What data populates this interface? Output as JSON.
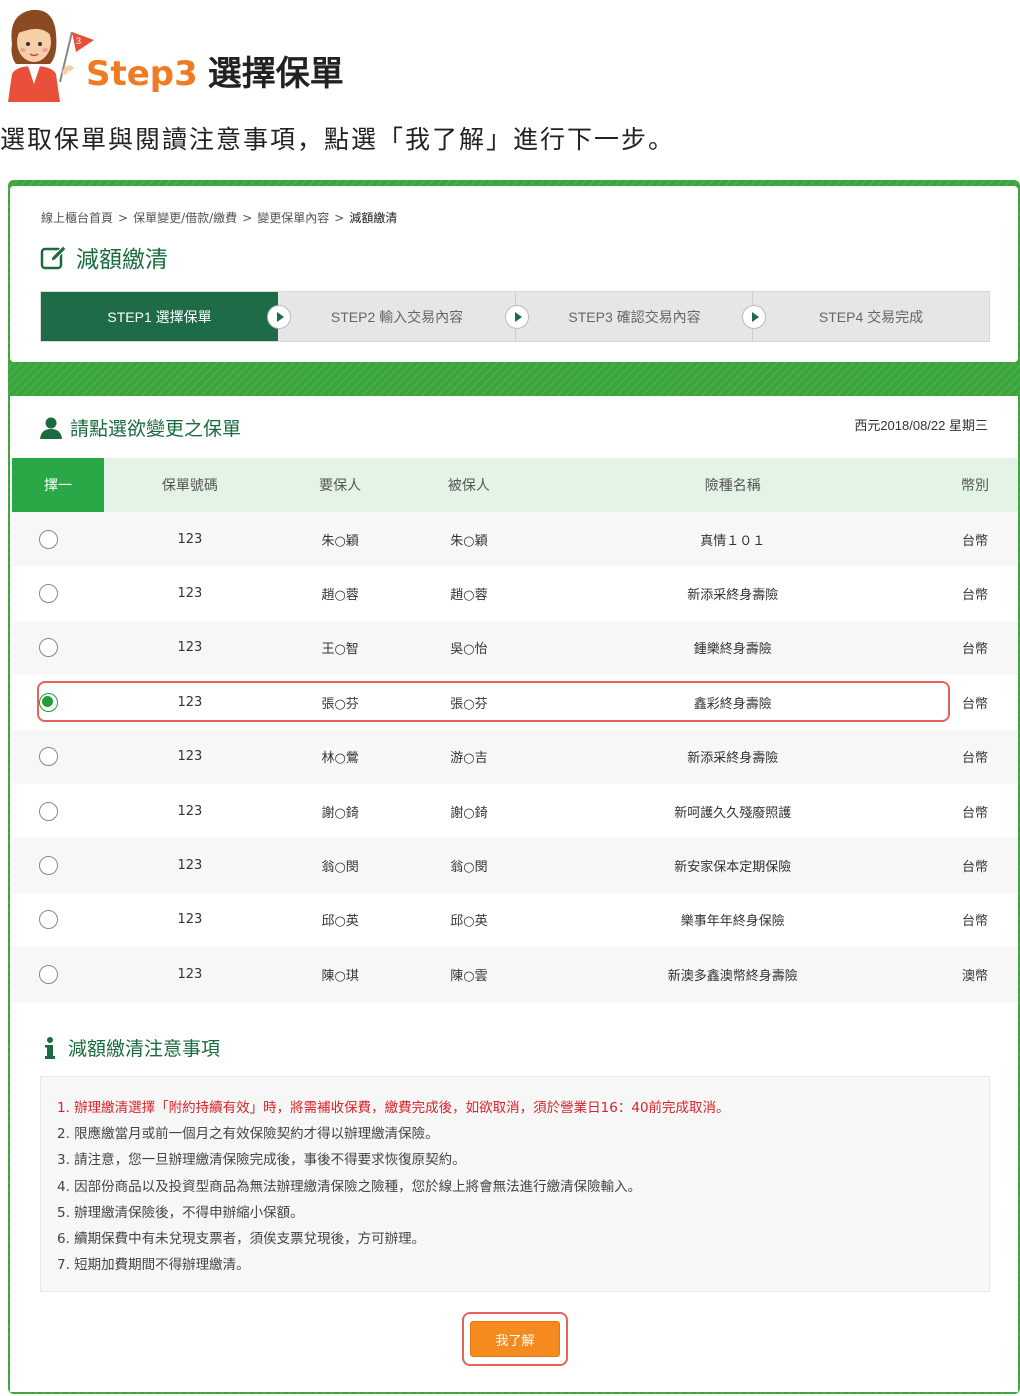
{
  "header": {
    "step_num": "Step3",
    "step_name": "選擇保單",
    "instruction": "選取保單與閱讀注意事項，點選「我了解」進行下一步。"
  },
  "breadcrumb": {
    "items": [
      "線上櫃台首頁",
      "保單變更/借款/繳費",
      "變更保單內容"
    ],
    "current": "減額繳清",
    "separator": ">"
  },
  "page_title": "減額繳清",
  "steps": [
    {
      "label": "STEP1 選擇保單",
      "active": true
    },
    {
      "label": "STEP2 輸入交易內容",
      "active": false
    },
    {
      "label": "STEP3 確認交易內容",
      "active": false
    },
    {
      "label": "STEP4 交易完成",
      "active": false
    }
  ],
  "policy_section": {
    "title": "請點選欲變更之保單",
    "date": "西元2018/08/22 星期三",
    "columns": [
      "擇一",
      "保單號碼",
      "要保人",
      "被保人",
      "險種名稱",
      "幣別"
    ],
    "rows": [
      {
        "no": "123",
        "applicant": "朱○穎",
        "insured": "朱○穎",
        "plan": "真情１０１",
        "currency": "台幣",
        "selected": false
      },
      {
        "no": "123",
        "applicant": "趙○蓉",
        "insured": "趙○蓉",
        "plan": "新添采終身壽險",
        "currency": "台幣",
        "selected": false
      },
      {
        "no": "123",
        "applicant": "王○智",
        "insured": "吳○怡",
        "plan": "鍾樂終身壽險",
        "currency": "台幣",
        "selected": false
      },
      {
        "no": "123",
        "applicant": "張○芬",
        "insured": "張○芬",
        "plan": "鑫彩終身壽險",
        "currency": "台幣",
        "selected": true
      },
      {
        "no": "123",
        "applicant": "林○鶯",
        "insured": "游○吉",
        "plan": "新添采終身壽險",
        "currency": "台幣",
        "selected": false
      },
      {
        "no": "123",
        "applicant": "謝○錡",
        "insured": "謝○錡",
        "plan": "新呵護久久殘廢照護",
        "currency": "台幣",
        "selected": false
      },
      {
        "no": "123",
        "applicant": "翁○閔",
        "insured": "翁○閔",
        "plan": "新安家保本定期保險",
        "currency": "台幣",
        "selected": false
      },
      {
        "no": "123",
        "applicant": "邱○英",
        "insured": "邱○英",
        "plan": "樂事年年終身保險",
        "currency": "台幣",
        "selected": false
      },
      {
        "no": "123",
        "applicant": "陳○琪",
        "insured": "陳○雲",
        "plan": "新澳多鑫澳幣終身壽險",
        "currency": "澳幣",
        "selected": false
      }
    ]
  },
  "notes": {
    "title": "減額繳清注意事項",
    "items": [
      "1. 辦理繳清選擇「附約持續有效」時，將需補收保費，繳費完成後，如欲取消，須於營業日16：40前完成取消。",
      "2. 限應繳當月或前一個月之有效保險契約才得以辦理繳清保險。",
      "3. 請注意，您一旦辦理繳清保險完成後，事後不得要求恢復原契約。",
      "4. 因部份商品以及投資型商品為無法辦理繳清保險之險種，您於線上將會無法進行繳清保險輸入。",
      "5. 辦理繳清保險後，不得申辦縮小保額。",
      "6. 續期保費中有未兌現支票者，須俟支票兌現後，方可辦理。",
      "7. 短期加費期間不得辦理繳清。"
    ]
  },
  "confirm_button": "我了解",
  "mascot_flag": "3",
  "colors": {
    "brand_green": "#1d6b47",
    "accent_orange": "#f58a1f",
    "highlight_red": "#e8615d",
    "warn_red": "#d9232a"
  }
}
